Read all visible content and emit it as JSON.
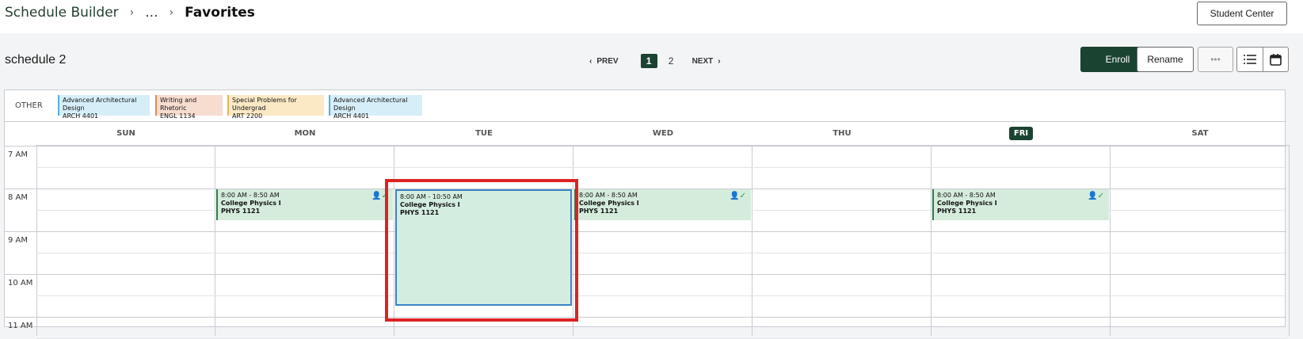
{
  "breadcrumb": {
    "root": "Schedule Builder",
    "ellipsis": "...",
    "current": "Favorites"
  },
  "header": {
    "student_center": "Student Center",
    "schedule_title": "schedule 2"
  },
  "pager": {
    "prev": "PREV",
    "next": "NEXT",
    "pages": [
      "1",
      "2"
    ],
    "active": "1"
  },
  "actions": {
    "enroll": "Enroll",
    "rename": "Rename",
    "more": "•••"
  },
  "other": {
    "label": "OTHER",
    "chips": [
      {
        "name": "Advanced Architectural Design",
        "code": "ARCH 4401",
        "color": "#d6eef8",
        "border": "#5aaed6"
      },
      {
        "name": "Writing and Rhetoric",
        "code": "ENGL 1134",
        "color": "#f7dcd0",
        "border": "#d98a63"
      },
      {
        "name": "Special Problems for Undergrad",
        "code": "ART 2200",
        "color": "#fbe9c6",
        "border": "#e0b45a"
      },
      {
        "name": "Advanced Architectural Design",
        "code": "ARCH 4401",
        "color": "#d6eef8",
        "border": "#5aaed6"
      }
    ]
  },
  "days": [
    "SUN",
    "MON",
    "TUE",
    "WED",
    "THU",
    "FRI",
    "SAT"
  ],
  "today": "FRI",
  "times": [
    "7 AM",
    "8 AM",
    "9 AM",
    "10 AM",
    "11 AM"
  ],
  "events": [
    {
      "day": "MON",
      "time": "8:00 AM - 8:50 AM",
      "name": "College Physics I",
      "code": "PHYS 1121"
    },
    {
      "day": "TUE",
      "time": "8:00 AM - 10:50 AM",
      "name": "College Physics I",
      "code": "PHYS 1121"
    },
    {
      "day": "WED",
      "time": "8:00 AM - 8:50 AM",
      "name": "College Physics I",
      "code": "PHYS 1121"
    },
    {
      "day": "FRI",
      "time": "8:00 AM - 8:50 AM",
      "name": "College Physics I",
      "code": "PHYS 1121"
    }
  ],
  "colors": {
    "accent": "#1b4332",
    "event_bg": "#d5ecdc",
    "highlight": "#dd2222"
  },
  "icons": {
    "enrolled": "person-check-icon",
    "list_view": "list-icon",
    "calendar_view": "calendar-icon"
  }
}
